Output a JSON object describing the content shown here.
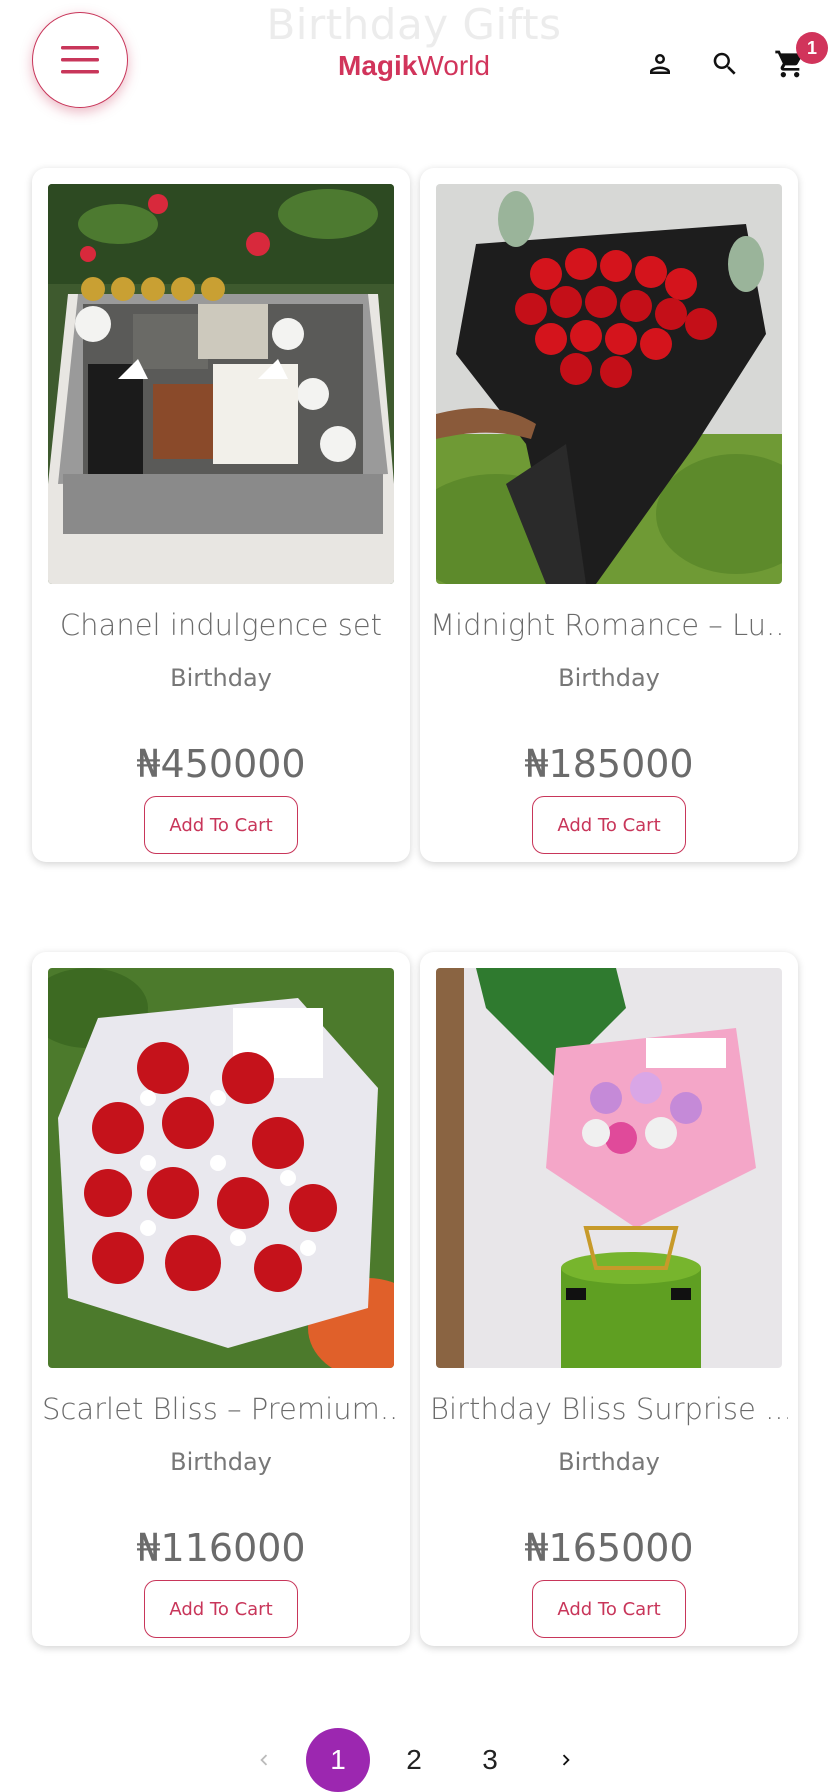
{
  "header": {
    "ghost_title": "Birthday Gifts",
    "logo_part1": "Magik",
    "logo_part2": "World",
    "cart_count": "1",
    "icons": [
      "menu-icon",
      "user-icon",
      "search-icon",
      "cart-icon"
    ]
  },
  "products": [
    {
      "name": "Chanel indulgence set",
      "category": "Birthday",
      "price": "₦450000",
      "cta": "Add To Cart"
    },
    {
      "name": "Midnight Romance – Lu...",
      "category": "Birthday",
      "price": "₦185000",
      "cta": "Add To Cart"
    },
    {
      "name": "Scarlet Bliss – Premium...",
      "category": "Birthday",
      "price": "₦116000",
      "cta": "Add To Cart"
    },
    {
      "name": "Birthday Bliss Surprise ...",
      "category": "Birthday",
      "price": "₦165000",
      "cta": "Add To Cart"
    }
  ],
  "pagination": {
    "pages": [
      "1",
      "2",
      "3"
    ],
    "current": "1",
    "icons": [
      "chevron-left-icon",
      "chevron-right-icon"
    ]
  },
  "colors": {
    "brand": "#d1345b",
    "pagination_active": "#9c27b0"
  }
}
